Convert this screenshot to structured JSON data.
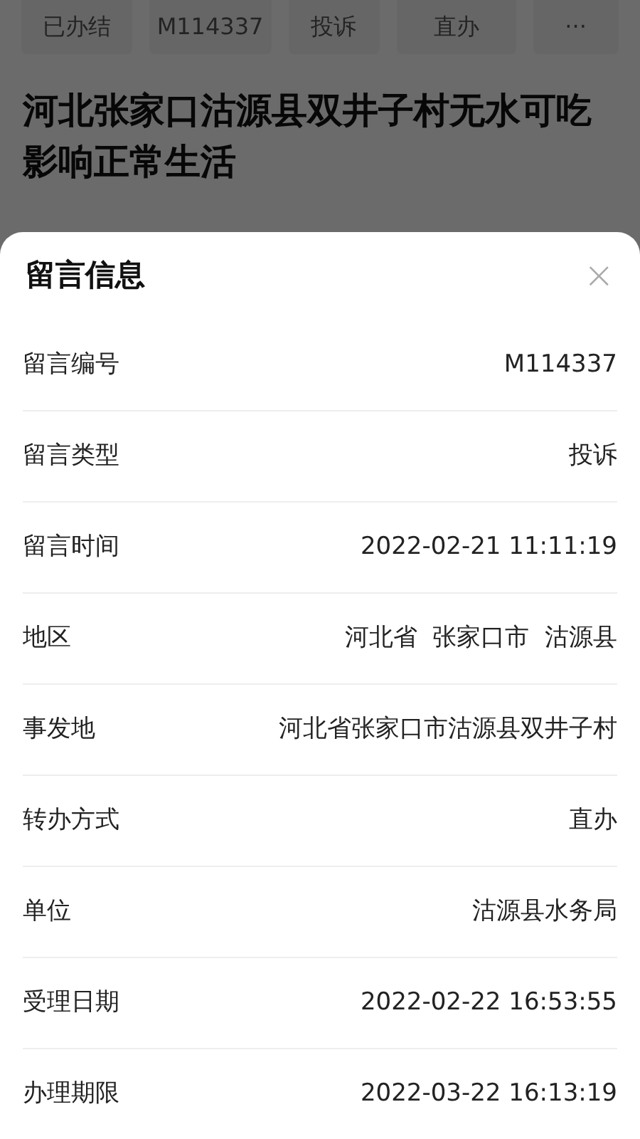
{
  "tags": [
    "已办结",
    "M114337",
    "投诉",
    "直办",
    "···"
  ],
  "title": "河北张家口沽源县双井子村无水可吃影响正常生活",
  "sheet": {
    "title": "留言信息",
    "close": "×",
    "rows": [
      {
        "label": "留言编号",
        "value": "M114337"
      },
      {
        "label": "留言类型",
        "value": "投诉"
      },
      {
        "label": "留言时间",
        "value": "2022-02-21 11:11:19"
      },
      {
        "label": "地区",
        "value": "河北省  张家口市  沽源县"
      },
      {
        "label": "事发地",
        "value": "河北省张家口市沽源县双井子村"
      },
      {
        "label": "转办方式",
        "value": "直办"
      },
      {
        "label": "单位",
        "value": "沽源县水务局"
      },
      {
        "label": "受理日期",
        "value": "2022-02-22 16:53:55"
      },
      {
        "label": "办理期限",
        "value": "2022-03-22 16:13:19"
      }
    ]
  }
}
